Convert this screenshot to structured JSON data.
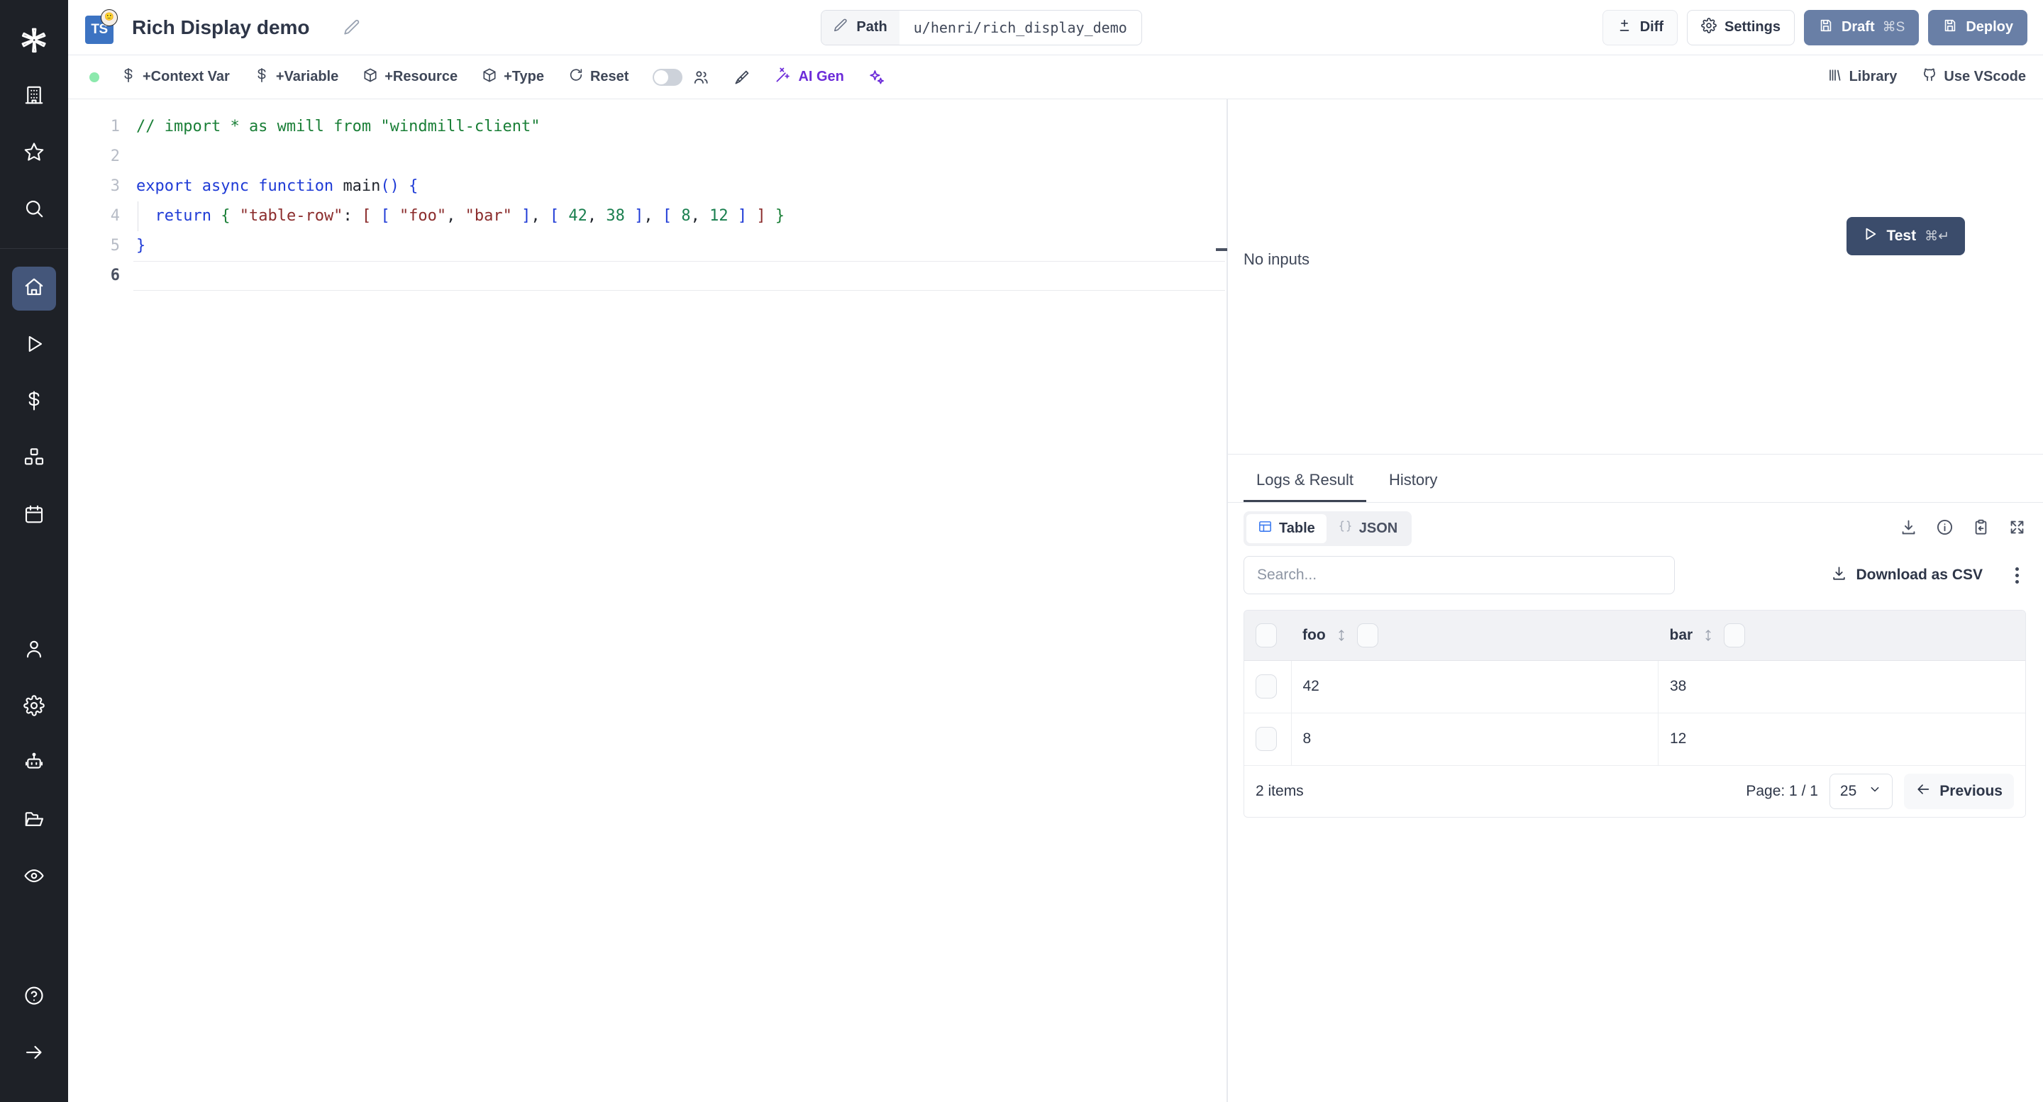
{
  "header": {
    "app_title": "Rich Display demo",
    "lang_badge": "TS",
    "edit_icon": "pencil-icon",
    "path_label": "Path",
    "path_value": "u/henri/rich_display_demo",
    "buttons": [
      {
        "id": "diff",
        "label": "Diff",
        "icon": "diff-icon",
        "kbd": ""
      },
      {
        "id": "settings",
        "label": "Settings",
        "icon": "gear-icon",
        "kbd": ""
      },
      {
        "id": "draft",
        "label": "Draft",
        "icon": "save-icon",
        "kbd": "⌘S"
      },
      {
        "id": "deploy",
        "label": "Deploy",
        "icon": "save-icon",
        "kbd": ""
      }
    ],
    "accent_blue": "#697fa6"
  },
  "toolbar": {
    "status_color": "#8ce9ad",
    "items": [
      {
        "id": "context-var",
        "label": "+Context Var",
        "icon": "dollar-icon"
      },
      {
        "id": "variable",
        "label": "+Variable",
        "icon": "dollar-icon"
      },
      {
        "id": "resource",
        "label": "+Resource",
        "icon": "box-icon"
      },
      {
        "id": "type",
        "label": "+Type",
        "icon": "box-icon"
      },
      {
        "id": "reset",
        "label": "Reset",
        "icon": "refresh-icon"
      }
    ],
    "toggle_on": false,
    "collab_icon": "users-icon",
    "format_icon": "brush-icon",
    "ai_gen_label": "AI Gen",
    "ai_gen_color": "#6c2bd9",
    "sparkles_icon": "sparkles-icon",
    "library_label": "Library",
    "library_icon": "library-icon",
    "vscode_label": "Use VScode",
    "vscode_icon": "github-icon"
  },
  "sidebar": {
    "logo_icon": "windmill-logo-icon",
    "top_items": [
      {
        "id": "workspace",
        "icon": "building-icon",
        "active": false
      },
      {
        "id": "favorites",
        "icon": "star-icon",
        "active": false
      },
      {
        "id": "search",
        "icon": "search-icon",
        "active": false
      }
    ],
    "main_items": [
      {
        "id": "home",
        "icon": "home-icon",
        "active": true
      },
      {
        "id": "runs",
        "icon": "play-icon",
        "active": false
      },
      {
        "id": "variables",
        "icon": "dollar-icon",
        "active": false
      },
      {
        "id": "resources",
        "icon": "boxes-icon",
        "active": false
      },
      {
        "id": "schedules",
        "icon": "calendar-icon",
        "active": false
      },
      {
        "id": "workers",
        "icon": "user-icon",
        "active": false
      },
      {
        "id": "settings",
        "icon": "gear-icon",
        "active": false
      },
      {
        "id": "agents",
        "icon": "bot-icon",
        "active": false
      },
      {
        "id": "folders",
        "icon": "folder-icon",
        "active": false
      },
      {
        "id": "audit",
        "icon": "eye-icon",
        "active": false
      }
    ],
    "bottom_items": [
      {
        "id": "help",
        "icon": "help-circle-icon",
        "active": false
      },
      {
        "id": "collapse",
        "icon": "arrow-right-icon",
        "active": false
      }
    ],
    "active_bg": "#44567a"
  },
  "editor": {
    "line_numbers": [
      "1",
      "2",
      "3",
      "4",
      "5",
      "6"
    ],
    "current_line": 6,
    "lines": [
      {
        "n": 1,
        "tokens": [
          {
            "t": "// import * as wmill from \"windmill-client\"",
            "c": "tok-com"
          }
        ]
      },
      {
        "n": 2,
        "tokens": []
      },
      {
        "n": 3,
        "tokens": [
          {
            "t": "export",
            "c": "tok-kw"
          },
          {
            "t": " ",
            "c": "tok-pun"
          },
          {
            "t": "async",
            "c": "tok-kw"
          },
          {
            "t": " ",
            "c": "tok-pun"
          },
          {
            "t": "function",
            "c": "tok-kw"
          },
          {
            "t": " ",
            "c": "tok-pun"
          },
          {
            "t": "main",
            "c": "tok-fn"
          },
          {
            "t": "()",
            "c": "tok-br"
          },
          {
            "t": " ",
            "c": "tok-pun"
          },
          {
            "t": "{",
            "c": "tok-br"
          }
        ]
      },
      {
        "n": 4,
        "tokens": [
          {
            "t": "  ",
            "c": "tok-pun"
          },
          {
            "t": "return",
            "c": "tok-kw"
          },
          {
            "t": " ",
            "c": "tok-pun"
          },
          {
            "t": "{",
            "c": "tok-brc"
          },
          {
            "t": " ",
            "c": "tok-pun"
          },
          {
            "t": "\"table-row\"",
            "c": "tok-str"
          },
          {
            "t": ":",
            "c": "tok-pun"
          },
          {
            "t": " ",
            "c": "tok-pun"
          },
          {
            "t": "[",
            "c": "tok-str"
          },
          {
            "t": " ",
            "c": "tok-pun"
          },
          {
            "t": "[",
            "c": "tok-br"
          },
          {
            "t": " ",
            "c": "tok-pun"
          },
          {
            "t": "\"foo\"",
            "c": "tok-str"
          },
          {
            "t": ",",
            "c": "tok-pun"
          },
          {
            "t": " ",
            "c": "tok-pun"
          },
          {
            "t": "\"bar\"",
            "c": "tok-str"
          },
          {
            "t": " ",
            "c": "tok-pun"
          },
          {
            "t": "]",
            "c": "tok-br"
          },
          {
            "t": ",",
            "c": "tok-pun"
          },
          {
            "t": " ",
            "c": "tok-pun"
          },
          {
            "t": "[",
            "c": "tok-br"
          },
          {
            "t": " ",
            "c": "tok-pun"
          },
          {
            "t": "42",
            "c": "tok-num"
          },
          {
            "t": ",",
            "c": "tok-pun"
          },
          {
            "t": " ",
            "c": "tok-pun"
          },
          {
            "t": "38",
            "c": "tok-num"
          },
          {
            "t": " ",
            "c": "tok-pun"
          },
          {
            "t": "]",
            "c": "tok-br"
          },
          {
            "t": ",",
            "c": "tok-pun"
          },
          {
            "t": " ",
            "c": "tok-pun"
          },
          {
            "t": "[",
            "c": "tok-br"
          },
          {
            "t": " ",
            "c": "tok-pun"
          },
          {
            "t": "8",
            "c": "tok-num"
          },
          {
            "t": ",",
            "c": "tok-pun"
          },
          {
            "t": " ",
            "c": "tok-pun"
          },
          {
            "t": "12",
            "c": "tok-num"
          },
          {
            "t": " ",
            "c": "tok-pun"
          },
          {
            "t": "]",
            "c": "tok-br"
          },
          {
            "t": " ",
            "c": "tok-pun"
          },
          {
            "t": "]",
            "c": "tok-str"
          },
          {
            "t": " ",
            "c": "tok-pun"
          },
          {
            "t": "}",
            "c": "tok-brc"
          }
        ]
      },
      {
        "n": 5,
        "tokens": [
          {
            "t": "}",
            "c": "tok-br"
          }
        ]
      },
      {
        "n": 6,
        "tokens": []
      }
    ]
  },
  "inputs": {
    "test_label": "Test",
    "test_kbd": "⌘↵",
    "play_icon": "play-icon",
    "empty_text": "No inputs"
  },
  "result": {
    "tabs": [
      {
        "id": "logs-result",
        "label": "Logs & Result",
        "active": true
      },
      {
        "id": "history",
        "label": "History",
        "active": false
      }
    ],
    "view_modes": [
      {
        "id": "table",
        "label": "Table",
        "icon": "table-icon",
        "active": true
      },
      {
        "id": "json",
        "label": "JSON",
        "icon": "braces-icon",
        "active": false
      }
    ],
    "action_icons": [
      {
        "id": "download",
        "icon": "download-icon"
      },
      {
        "id": "info",
        "icon": "info-icon"
      },
      {
        "id": "clipboard",
        "icon": "clipboard-paste-icon"
      },
      {
        "id": "expand",
        "icon": "expand-icon"
      }
    ],
    "search_placeholder": "Search...",
    "csv_label": "Download as CSV",
    "csv_icon": "download-icon",
    "kebab_icon": "more-vertical-icon",
    "table": {
      "columns": [
        "foo",
        "bar"
      ],
      "rows": [
        [
          "42",
          "38"
        ],
        [
          "8",
          "12"
        ]
      ]
    },
    "footer": {
      "items_label": "2 items",
      "page_label": "Page: 1 / 1",
      "page_size": "25",
      "prev_label": "Previous",
      "prev_icon": "arrow-left-icon"
    }
  }
}
